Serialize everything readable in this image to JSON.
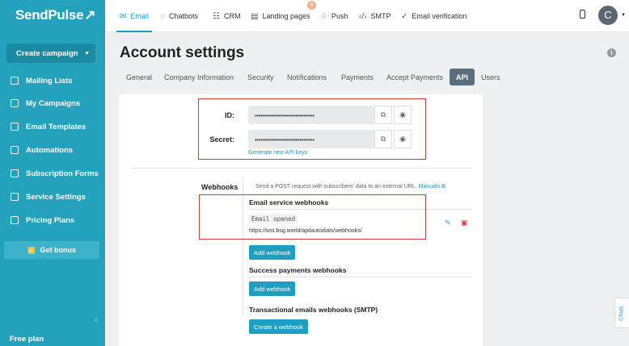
{
  "logo": {
    "text": "SendPulse",
    "mark": "↗"
  },
  "sidebar": {
    "create_label": "Create campaign",
    "items": [
      {
        "label": "Mailing Lists",
        "icon": "list-icon"
      },
      {
        "label": "My Campaigns",
        "icon": "campaign-icon"
      },
      {
        "label": "Email Templates",
        "icon": "template-icon"
      },
      {
        "label": "Automations",
        "icon": "automation-icon"
      },
      {
        "label": "Subscription Forms",
        "icon": "form-icon"
      },
      {
        "label": "Service Settings",
        "icon": "settings-icon"
      },
      {
        "label": "Pricing Plans",
        "icon": "pricing-icon"
      }
    ],
    "bonus_label": "Get bonus",
    "plan_label": "Free plan"
  },
  "topnav": {
    "tabs": [
      {
        "label": "Email",
        "icon": "✉"
      },
      {
        "label": "Chatbots",
        "icon": "◌"
      },
      {
        "label": "CRM",
        "icon": "☷"
      },
      {
        "label": "Landing pages",
        "icon": "▤"
      },
      {
        "label": "Push",
        "icon": "♢"
      },
      {
        "label": "SMTP",
        "icon": "‹/›"
      },
      {
        "label": "Email verification",
        "icon": "✓"
      }
    ],
    "push_badge": "8",
    "avatar_initial": "C"
  },
  "page": {
    "title": "Account settings",
    "tabs": [
      "General",
      "Company Information",
      "Security",
      "Notifications",
      "Payments",
      "Accept Payments",
      "API",
      "Users"
    ],
    "active_tab": "API"
  },
  "api": {
    "id_label": "ID:",
    "id_value": "••••••••••••••••••••••••••••••••",
    "secret_label": "Secret:",
    "secret_value": "••••••••••••••••••••••••••••••••",
    "generate_link": "Generate new API keys"
  },
  "webhooks": {
    "label": "Webhooks",
    "description": "Send a POST request with subscribers' data to an external URL.",
    "manuals_link": "Manuals ⧉",
    "email_section": "Email service webhooks",
    "event": "Email opened",
    "url": "https://wst.bsg.world/apilautodials/webhooks/",
    "add_label": "Add webhook",
    "payments_section": "Success payments webhooks",
    "smtp_section": "Transactional emails webhooks (SMTP)",
    "create_label": "Create a webhook"
  },
  "chats_label": "Chats",
  "colors": {
    "sidebar": "#24a2bd",
    "accent": "#1f9fc0",
    "highlight": "#e0373a"
  }
}
